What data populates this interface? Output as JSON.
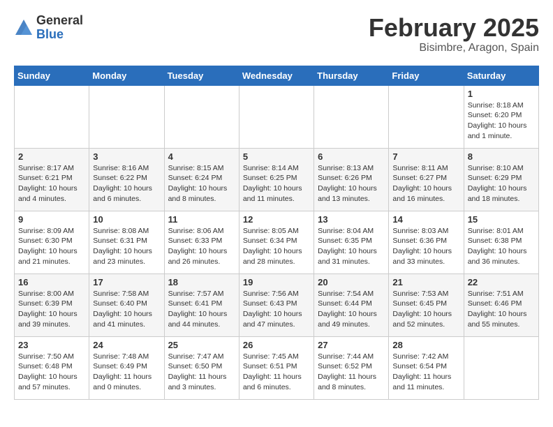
{
  "header": {
    "logo_general": "General",
    "logo_blue": "Blue",
    "title": "February 2025",
    "subtitle": "Bisimbre, Aragon, Spain"
  },
  "weekdays": [
    "Sunday",
    "Monday",
    "Tuesday",
    "Wednesday",
    "Thursday",
    "Friday",
    "Saturday"
  ],
  "weeks": [
    [
      {
        "day": "",
        "info": ""
      },
      {
        "day": "",
        "info": ""
      },
      {
        "day": "",
        "info": ""
      },
      {
        "day": "",
        "info": ""
      },
      {
        "day": "",
        "info": ""
      },
      {
        "day": "",
        "info": ""
      },
      {
        "day": "1",
        "info": "Sunrise: 8:18 AM\nSunset: 6:20 PM\nDaylight: 10 hours\nand 1 minute."
      }
    ],
    [
      {
        "day": "2",
        "info": "Sunrise: 8:17 AM\nSunset: 6:21 PM\nDaylight: 10 hours\nand 4 minutes."
      },
      {
        "day": "3",
        "info": "Sunrise: 8:16 AM\nSunset: 6:22 PM\nDaylight: 10 hours\nand 6 minutes."
      },
      {
        "day": "4",
        "info": "Sunrise: 8:15 AM\nSunset: 6:24 PM\nDaylight: 10 hours\nand 8 minutes."
      },
      {
        "day": "5",
        "info": "Sunrise: 8:14 AM\nSunset: 6:25 PM\nDaylight: 10 hours\nand 11 minutes."
      },
      {
        "day": "6",
        "info": "Sunrise: 8:13 AM\nSunset: 6:26 PM\nDaylight: 10 hours\nand 13 minutes."
      },
      {
        "day": "7",
        "info": "Sunrise: 8:11 AM\nSunset: 6:27 PM\nDaylight: 10 hours\nand 16 minutes."
      },
      {
        "day": "8",
        "info": "Sunrise: 8:10 AM\nSunset: 6:29 PM\nDaylight: 10 hours\nand 18 minutes."
      }
    ],
    [
      {
        "day": "9",
        "info": "Sunrise: 8:09 AM\nSunset: 6:30 PM\nDaylight: 10 hours\nand 21 minutes."
      },
      {
        "day": "10",
        "info": "Sunrise: 8:08 AM\nSunset: 6:31 PM\nDaylight: 10 hours\nand 23 minutes."
      },
      {
        "day": "11",
        "info": "Sunrise: 8:06 AM\nSunset: 6:33 PM\nDaylight: 10 hours\nand 26 minutes."
      },
      {
        "day": "12",
        "info": "Sunrise: 8:05 AM\nSunset: 6:34 PM\nDaylight: 10 hours\nand 28 minutes."
      },
      {
        "day": "13",
        "info": "Sunrise: 8:04 AM\nSunset: 6:35 PM\nDaylight: 10 hours\nand 31 minutes."
      },
      {
        "day": "14",
        "info": "Sunrise: 8:03 AM\nSunset: 6:36 PM\nDaylight: 10 hours\nand 33 minutes."
      },
      {
        "day": "15",
        "info": "Sunrise: 8:01 AM\nSunset: 6:38 PM\nDaylight: 10 hours\nand 36 minutes."
      }
    ],
    [
      {
        "day": "16",
        "info": "Sunrise: 8:00 AM\nSunset: 6:39 PM\nDaylight: 10 hours\nand 39 minutes."
      },
      {
        "day": "17",
        "info": "Sunrise: 7:58 AM\nSunset: 6:40 PM\nDaylight: 10 hours\nand 41 minutes."
      },
      {
        "day": "18",
        "info": "Sunrise: 7:57 AM\nSunset: 6:41 PM\nDaylight: 10 hours\nand 44 minutes."
      },
      {
        "day": "19",
        "info": "Sunrise: 7:56 AM\nSunset: 6:43 PM\nDaylight: 10 hours\nand 47 minutes."
      },
      {
        "day": "20",
        "info": "Sunrise: 7:54 AM\nSunset: 6:44 PM\nDaylight: 10 hours\nand 49 minutes."
      },
      {
        "day": "21",
        "info": "Sunrise: 7:53 AM\nSunset: 6:45 PM\nDaylight: 10 hours\nand 52 minutes."
      },
      {
        "day": "22",
        "info": "Sunrise: 7:51 AM\nSunset: 6:46 PM\nDaylight: 10 hours\nand 55 minutes."
      }
    ],
    [
      {
        "day": "23",
        "info": "Sunrise: 7:50 AM\nSunset: 6:48 PM\nDaylight: 10 hours\nand 57 minutes."
      },
      {
        "day": "24",
        "info": "Sunrise: 7:48 AM\nSunset: 6:49 PM\nDaylight: 11 hours\nand 0 minutes."
      },
      {
        "day": "25",
        "info": "Sunrise: 7:47 AM\nSunset: 6:50 PM\nDaylight: 11 hours\nand 3 minutes."
      },
      {
        "day": "26",
        "info": "Sunrise: 7:45 AM\nSunset: 6:51 PM\nDaylight: 11 hours\nand 6 minutes."
      },
      {
        "day": "27",
        "info": "Sunrise: 7:44 AM\nSunset: 6:52 PM\nDaylight: 11 hours\nand 8 minutes."
      },
      {
        "day": "28",
        "info": "Sunrise: 7:42 AM\nSunset: 6:54 PM\nDaylight: 11 hours\nand 11 minutes."
      },
      {
        "day": "",
        "info": ""
      }
    ]
  ]
}
